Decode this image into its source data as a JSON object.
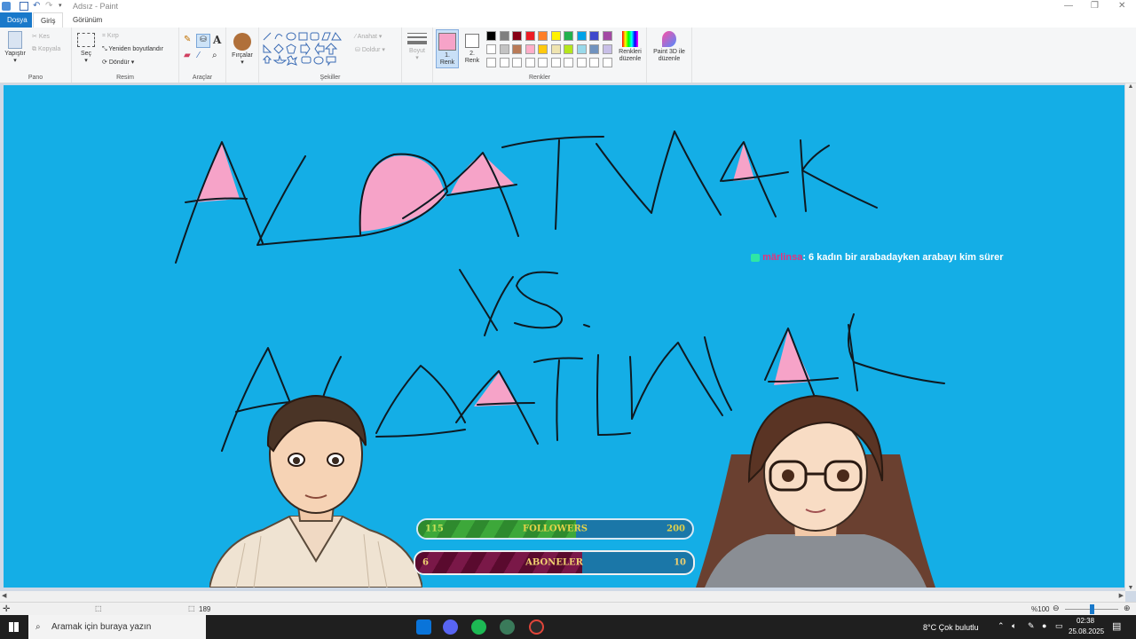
{
  "window": {
    "title": "Adsız - Paint"
  },
  "tabs": {
    "file": "Dosya",
    "home": "Giriş",
    "view": "Görünüm"
  },
  "ribbon": {
    "clipboard": {
      "group": "Pano",
      "paste": "Yapıştır",
      "cut": "Kes",
      "copy": "Kopyala"
    },
    "image": {
      "group": "Resim",
      "select": "Seç",
      "crop": "Kırp",
      "resize": "Yeniden boyutlandır",
      "rotate": "Döndür"
    },
    "tools": {
      "group": "Araçlar"
    },
    "brushes": {
      "label": "Fırçalar"
    },
    "shapes": {
      "group": "Şekiller",
      "outline": "Anahat",
      "fill": "Doldur"
    },
    "size": {
      "label": "Boyut"
    },
    "colors": {
      "group": "Renkler",
      "color1": "1. Renk",
      "color2": "2. Renk",
      "edit": "Renkleri düzenle",
      "color1_value": "#f6a3c8",
      "palette_row1": [
        "#000000",
        "#7f7f7f",
        "#880015",
        "#ed1c24",
        "#ff7f27",
        "#fff200",
        "#22b14c",
        "#00a2e8",
        "#3f48cc",
        "#a349a4"
      ],
      "palette_row2": [
        "#ffffff",
        "#c3c3c3",
        "#b97a57",
        "#ffaec9",
        "#ffc90e",
        "#efe4b0",
        "#b5e61d",
        "#99d9ea",
        "#7092be",
        "#c8bfe7"
      ]
    },
    "paint3d": "Paint 3D ile düzenle"
  },
  "canvas": {
    "background": "#14aee6",
    "drawing_text": [
      "ALDATMAK",
      "VS.",
      "ALDATILMAK"
    ],
    "chat": {
      "user": "märlinsa",
      "message": ": 6 kadın bir arabadayken arabayı kim sürer"
    }
  },
  "followers_bar": {
    "current": "115",
    "label": "FOLLOWERS",
    "goal": "200",
    "progress": 0.575
  },
  "subscribers_bar": {
    "current": "6",
    "label": "ABONELER",
    "goal": "10",
    "progress": 0.6
  },
  "status": {
    "zoom": "%100",
    "size": "189"
  },
  "taskbar": {
    "search_placeholder": "Aramak için buraya yazın",
    "weather": "8°C  Çok bulutlu",
    "time": "02:38",
    "date": "25.08.2025"
  }
}
